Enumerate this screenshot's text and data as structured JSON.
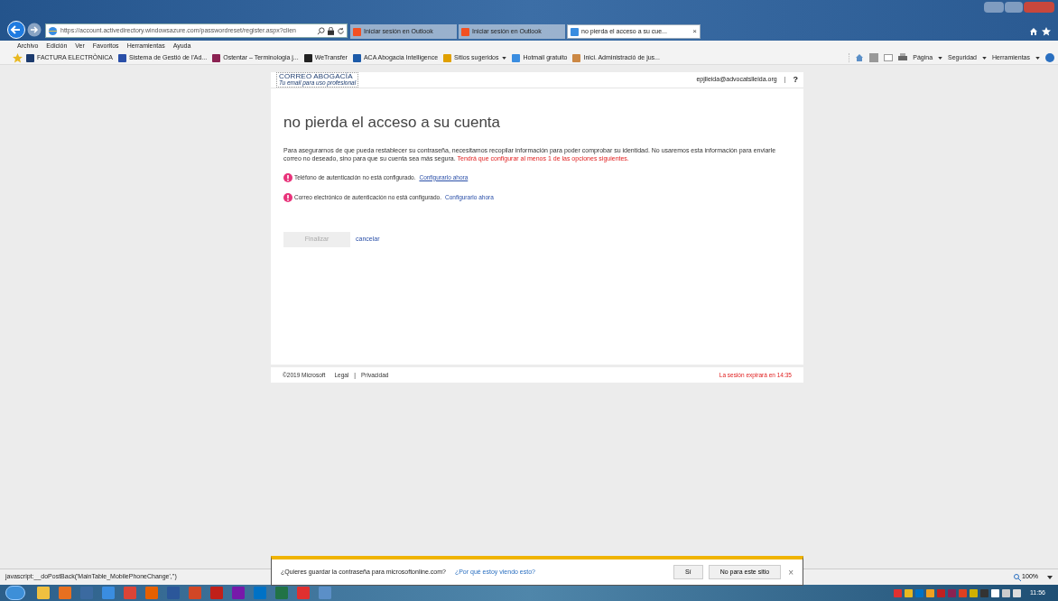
{
  "browser": {
    "address": "https://account.activedirectory.windowsazure.com/passwordreset/register.aspx?clien",
    "tabs": [
      {
        "label": "Iniciar sesión en Outlook",
        "selected": false
      },
      {
        "label": "Iniciar sesión en Outlook",
        "selected": false
      },
      {
        "label": "no pierda el acceso a su cue...",
        "selected": true,
        "close": "×"
      }
    ],
    "menu": [
      "Archivo",
      "Edición",
      "Ver",
      "Favoritos",
      "Herramientas",
      "Ayuda"
    ],
    "favorites": [
      {
        "label": "FACTURA ELECTRÒNICA",
        "dropdown": false
      },
      {
        "label": "Sistema de Gestió de l'Ad...",
        "dropdown": false
      },
      {
        "label": "Ostentar – Terminologia j...",
        "dropdown": false
      },
      {
        "label": "WeTransfer",
        "dropdown": false
      },
      {
        "label": "ACA Abogacia Intelligence",
        "dropdown": false
      },
      {
        "label": "Sitios sugeridos",
        "dropdown": true
      },
      {
        "label": "Hotmail gratuito",
        "dropdown": false
      },
      {
        "label": "Inici. Administració de jus...",
        "dropdown": false
      }
    ],
    "command_bar": [
      "Página",
      "Seguridad",
      "Herramientas"
    ]
  },
  "page": {
    "logo": {
      "title": "CORREO ABOGACÍA",
      "tagline": "Tu email para uso profesional"
    },
    "user": "epjlleida@advocatslleida.org",
    "header_separator": "|",
    "help": "?",
    "heading": "no pierda el acceso a su cuenta",
    "intro": "Para asegurarnos de que pueda restablecer su contraseña, necesitamos recopilar información para poder comprobar su identidad. No usaremos esta información para enviarle correo no deseado, sino para que su cuenta sea más segura.",
    "warning": "Tendrá que configurar al menos 1 de las opciones siguientes.",
    "items": [
      {
        "text": "Teléfono de autenticación no está configurado.",
        "link": "Configurarlo ahora",
        "underlined": true
      },
      {
        "text": "Correo electrónico de autenticación no está configurado.",
        "link": "Configurarlo ahora",
        "underlined": false
      }
    ],
    "finish": {
      "label": "Finalizar",
      "disabled": true
    },
    "cancel": "cancelar",
    "footer": {
      "copyright": "©2019 Microsoft",
      "links": [
        "Legal",
        "Privacidad"
      ],
      "separator": "|",
      "session": "La sesión expirará en 14:35"
    }
  },
  "status_bar": {
    "text": "javascript:__doPostBack('MainTable_MobilePhoneChange','')",
    "zoom": "100%"
  },
  "password_prompt": {
    "question": "¿Quieres guardar la contraseña para microsoftonline.com?",
    "link": "¿Por qué estoy viendo esto?",
    "buttons": [
      "Sí",
      "No para este sitio"
    ],
    "close": "×"
  },
  "taskbar": {
    "clock": "11:56"
  }
}
